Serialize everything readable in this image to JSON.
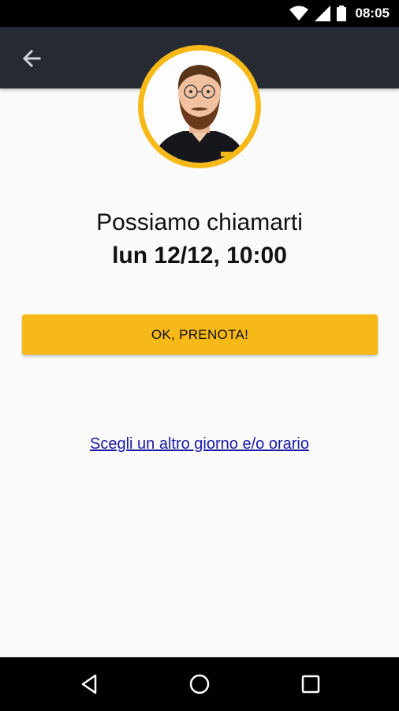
{
  "status_bar": {
    "time": "08:05",
    "icons": [
      "wifi-icon",
      "signal-icon",
      "battery-icon"
    ]
  },
  "app_bar": {
    "back_icon": "arrow-left-icon"
  },
  "avatar": {
    "description_icon": "agent-avatar"
  },
  "main": {
    "headline": "Possiamo chiamarti",
    "datetime": "lun 12/12, 10:00",
    "confirm_button": "OK, PRENOTA!",
    "alt_link": "Scegli un altro giorno e/o orario"
  },
  "nav_bar": {
    "icons": [
      "back-triangle-icon",
      "home-circle-icon",
      "recents-square-icon"
    ]
  },
  "colors": {
    "accent": "#f7b917",
    "app_bar": "#262b33",
    "link": "#1a1aa6"
  }
}
